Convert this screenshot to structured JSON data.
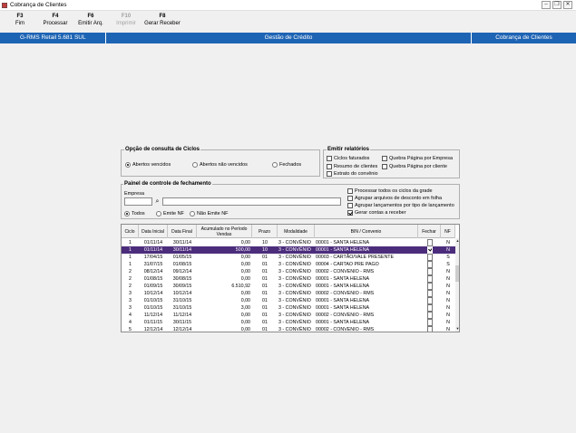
{
  "window": {
    "title": "Cobrança de Clientes"
  },
  "toolbar": {
    "buttons": [
      {
        "key": "F3",
        "label": "Fim"
      },
      {
        "key": "F4",
        "label": "Processar"
      },
      {
        "key": "F6",
        "label": "Emitir Arq."
      },
      {
        "key": "F10",
        "label": "Imprimir"
      },
      {
        "key": "F8",
        "label": "Gerar Receber"
      }
    ]
  },
  "header": {
    "system": "G-RMS Retail 5.681 SUL",
    "module": "Gestão de Crédito",
    "screen": "Cobrança de Clientes"
  },
  "consulta": {
    "title": "Opção de consulta de Ciclos",
    "options": [
      "Abertos vencidos",
      "Abertos não vencidos",
      "Fechados"
    ],
    "selected": "Abertos vencidos"
  },
  "relatorios": {
    "title": "Emitir relatórios",
    "items": [
      "Ciclos faturados",
      "Resumo de clientes",
      "Extrato do convênio",
      "Quebra Página por Empresa",
      "Quebra Página por cliente"
    ]
  },
  "painel": {
    "title": "Painel de controle de fechamento",
    "empresa_label": "Empresa",
    "empresa_code": "",
    "empresa_name": "",
    "nf_options": [
      "Todos",
      "Emite NF",
      "Não Emite NF"
    ],
    "nf_selected": "Todos",
    "checks": [
      {
        "label": "Processar todos os ciclos da grade",
        "checked": false
      },
      {
        "label": "Agrupar arquivos de desconto em folha",
        "checked": false
      },
      {
        "label": "Agrupar lançamentos por tipo de lançamento",
        "checked": false
      },
      {
        "label": "Gerar contas a receber",
        "checked": true
      }
    ]
  },
  "grid": {
    "columns": [
      "Ciclo",
      "Data Inicial",
      "Data Final",
      "Acumulado no Período Vendas",
      "Prazo",
      "Modalidade",
      "BIN / Convenio",
      "Fechar",
      "NF"
    ],
    "rows": [
      {
        "ciclo": "1",
        "ini": "01/11/14",
        "fim": "30/11/14",
        "acum": "0,00",
        "prazo": "10",
        "mod": "3 - CONVÊNIO",
        "bin": "00001 - SANTA HELENA",
        "fechar": false,
        "nf": "N",
        "sel": false
      },
      {
        "ciclo": "1",
        "ini": "01/11/14",
        "fim": "30/11/14",
        "acum": "500,00",
        "prazo": "10",
        "mod": "3 - CONVÊNIO",
        "bin": "00001 - SANTA HELENA",
        "fechar": true,
        "nf": "N",
        "sel": true
      },
      {
        "ciclo": "1",
        "ini": "17/04/15",
        "fim": "01/05/15",
        "acum": "0,00",
        "prazo": "01",
        "mod": "3 - CONVÊNIO",
        "bin": "00003 - CARTÃO/VALE PRESENTE",
        "fechar": false,
        "nf": "S",
        "sel": false
      },
      {
        "ciclo": "1",
        "ini": "31/07/15",
        "fim": "01/08/15",
        "acum": "0,00",
        "prazo": "01",
        "mod": "3 - CONVÊNIO",
        "bin": "00004 - CARTAO PRE PAGO",
        "fechar": false,
        "nf": "S",
        "sel": false
      },
      {
        "ciclo": "2",
        "ini": "08/12/14",
        "fim": "09/12/14",
        "acum": "0,00",
        "prazo": "01",
        "mod": "3 - CONVÊNIO",
        "bin": "00002 - CONVENIO - RMS",
        "fechar": false,
        "nf": "N",
        "sel": false
      },
      {
        "ciclo": "2",
        "ini": "01/08/15",
        "fim": "30/08/15",
        "acum": "0,00",
        "prazo": "01",
        "mod": "3 - CONVÊNIO",
        "bin": "00001 - SANTA HELENA",
        "fechar": false,
        "nf": "N",
        "sel": false
      },
      {
        "ciclo": "2",
        "ini": "01/09/15",
        "fim": "30/09/15",
        "acum": "6.510,92",
        "prazo": "01",
        "mod": "3 - CONVÊNIO",
        "bin": "00001 - SANTA HELENA",
        "fechar": false,
        "nf": "N",
        "sel": false
      },
      {
        "ciclo": "3",
        "ini": "10/12/14",
        "fim": "10/12/14",
        "acum": "0,00",
        "prazo": "01",
        "mod": "3 - CONVÊNIO",
        "bin": "00002 - CONVENIO - RMS",
        "fechar": false,
        "nf": "N",
        "sel": false
      },
      {
        "ciclo": "3",
        "ini": "01/10/15",
        "fim": "31/10/15",
        "acum": "0,00",
        "prazo": "01",
        "mod": "3 - CONVÊNIO",
        "bin": "00001 - SANTA HELENA",
        "fechar": false,
        "nf": "N",
        "sel": false
      },
      {
        "ciclo": "3",
        "ini": "01/10/15",
        "fim": "31/10/15",
        "acum": "3,00",
        "prazo": "01",
        "mod": "3 - CONVÊNIO",
        "bin": "00001 - SANTA HELENA",
        "fechar": false,
        "nf": "N",
        "sel": false
      },
      {
        "ciclo": "4",
        "ini": "11/12/14",
        "fim": "11/12/14",
        "acum": "0,00",
        "prazo": "01",
        "mod": "3 - CONVÊNIO",
        "bin": "00002 - CONVENIO - RMS",
        "fechar": false,
        "nf": "N",
        "sel": false
      },
      {
        "ciclo": "4",
        "ini": "01/11/15",
        "fim": "30/11/15",
        "acum": "0,00",
        "prazo": "01",
        "mod": "3 - CONVÊNIO",
        "bin": "00001 - SANTA HELENA",
        "fechar": false,
        "nf": "N",
        "sel": false
      },
      {
        "ciclo": "5",
        "ini": "12/12/14",
        "fim": "12/12/14",
        "acum": "0,00",
        "prazo": "01",
        "mod": "3 - CONVÊNIO",
        "bin": "00002 - CONVENIO - RMS",
        "fechar": false,
        "nf": "N",
        "sel": false
      }
    ]
  }
}
